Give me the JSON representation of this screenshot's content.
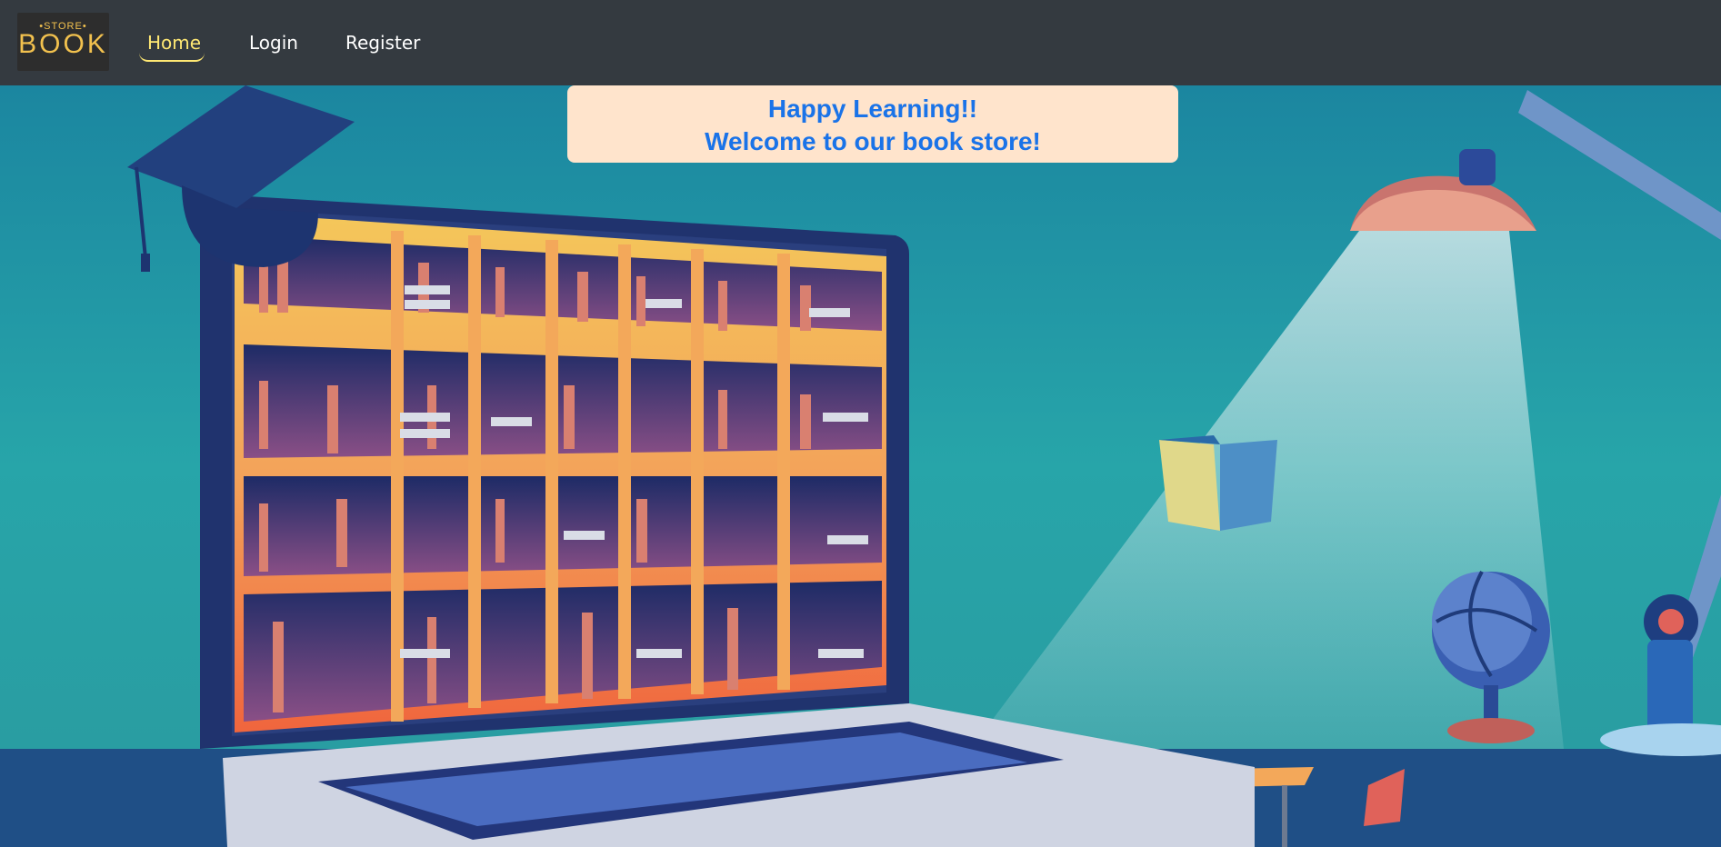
{
  "logo": {
    "small": "•STORE•",
    "big": "BOOK"
  },
  "nav": {
    "home": "Home",
    "login": "Login",
    "register": "Register"
  },
  "banner": {
    "line1": "Happy Learning!!",
    "line2": "Welcome to our book store!"
  },
  "colors": {
    "navbar": "#343a40",
    "active": "#ffe873",
    "banner_bg": "#ffe4cc",
    "banner_text": "#1a73e8"
  }
}
